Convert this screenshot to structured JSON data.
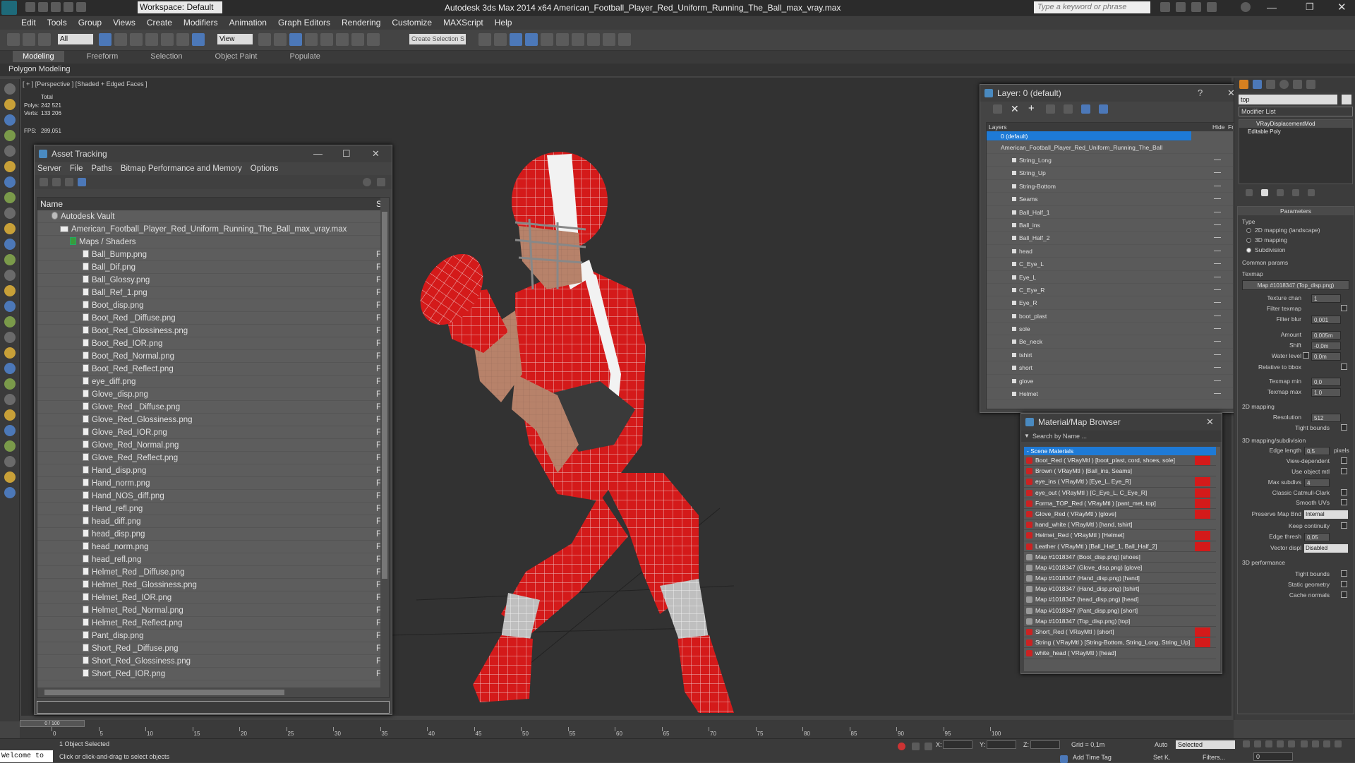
{
  "window": {
    "title": "Autodesk 3ds Max  2014 x64    American_Football_Player_Red_Uniform_Running_The_Ball_max_vray.max",
    "workspace": "Workspace: Default",
    "search_placeholder": "Type a keyword or phrase"
  },
  "menu": [
    "Edit",
    "Tools",
    "Group",
    "Views",
    "Create",
    "Modifiers",
    "Animation",
    "Graph Editors",
    "Rendering",
    "Customize",
    "MAXScript",
    "Help"
  ],
  "toolbar": {
    "selection_filter": "All",
    "ref_coord": "View",
    "named_selection": "Create Selection S"
  },
  "ribbon": {
    "tabs": [
      "Modeling",
      "Freeform",
      "Selection",
      "Object Paint",
      "Populate"
    ],
    "sub": "Polygon Modeling"
  },
  "viewport": {
    "label": "[ + ] [Perspective ] [Shaded + Edged Faces ]",
    "stats": {
      "total_label": "Total",
      "polys_label": "Polys:",
      "polys": "242 521",
      "verts_label": "Verts:",
      "verts": "133 206",
      "fps_label": "FPS:",
      "fps": "289,051"
    }
  },
  "asset_tracking": {
    "title": "Asset Tracking",
    "menu": [
      "Server",
      "File",
      "Paths",
      "Bitmap Performance and Memory",
      "Options"
    ],
    "col_name": "Name",
    "col_s": "S",
    "vault": "Autodesk Vault",
    "file": "American_Football_Player_Red_Uniform_Running_The_Ball_max_vray.max",
    "folder": "Maps / Shaders",
    "status_char": "F",
    "items": [
      "Ball_Bump.png",
      "Ball_Dif.png",
      "Ball_Glossy.png",
      "Ball_Ref_1.png",
      "Boot_disp.png",
      "Boot_Red _Diffuse.png",
      "Boot_Red_Glossiness.png",
      "Boot_Red_IOR.png",
      "Boot_Red_Normal.png",
      "Boot_Red_Reflect.png",
      "eye_diff.png",
      "Glove_disp.png",
      "Glove_Red _Diffuse.png",
      "Glove_Red_Glossiness.png",
      "Glove_Red_IOR.png",
      "Glove_Red_Normal.png",
      "Glove_Red_Reflect.png",
      "Hand_disp.png",
      "Hand_norm.png",
      "Hand_NOS_diff.png",
      "Hand_refl.png",
      "head_diff.png",
      "head_disp.png",
      "head_norm.png",
      "head_refl.png",
      "Helmet_Red _Diffuse.png",
      "Helmet_Red_Glossiness.png",
      "Helmet_Red_IOR.png",
      "Helmet_Red_Normal.png",
      "Helmet_Red_Reflect.png",
      "Pant_disp.png",
      "Short_Red _Diffuse.png",
      "Short_Red_Glossiness.png",
      "Short_Red_IOR.png"
    ]
  },
  "layers": {
    "title": "Layer: 0 (default)",
    "header": "Layers",
    "hide": "Hide",
    "fr": "Fr",
    "default_layer": "0 (default)",
    "main_layer": "American_Football_Player_Red_Uniform_Running_The_Ball",
    "items": [
      "String_Long",
      "String_Up",
      "String-Bottom",
      "Seams",
      "Ball_Half_1",
      "Ball_ins",
      "Ball_Half_2",
      "head",
      "C_Eye_L",
      "Eye_L",
      "C_Eye_R",
      "Eye_R",
      "boot_plast",
      "sole",
      "Be_neck",
      "tshirt",
      "short",
      "glove",
      "Helmet"
    ]
  },
  "material_browser": {
    "title": "Material/Map Browser",
    "search": "Search by Name ...",
    "section": "- Scene Materials",
    "items": [
      "Boot_Red  ( VRayMtl ) [boot_plast, cord, shoes, sole]",
      "Brown  ( VRayMtl ) [Ball_ins, Seams]",
      "eye_ins  ( VRayMtl ) [Eye_L, Eye_R]",
      "eye_out  ( VRayMtl ) [C_Eye_L, C_Eye_R]",
      "Forma_TOP_Red  ( VRayMtl ) [pant_met, top]",
      "Glove_Red  ( VRayMtl ) [glove]",
      "hand_white  ( VRayMtl ) [hand, tshirt]",
      "Helmet_Red  ( VRayMtl ) [Helmet]",
      "Leather  ( VRayMtl ) [Ball_Half_1, Ball_Half_2]",
      "Map #1018347 (Boot_disp.png) [shoes]",
      "Map #1018347 (Glove_disp.png) [glove]",
      "Map #1018347 (Hand_disp.png) [hand]",
      "Map #1018347 (Hand_disp.png) [tshirt]",
      "Map #1018347 (head_disp.png) [head]",
      "Map #1018347 (Pant_disp.png) [short]",
      "Map #1018347 (Top_disp.png) [top]",
      "Short_Red  ( VRayMtl ) [short]",
      "String  ( VRayMtl ) [String-Bottom, String_Long, String_Up]",
      "white_head  ( VRayMtl ) [head]"
    ]
  },
  "command_panel": {
    "name_field": "top",
    "modifier_list": "Modifier List",
    "stack": [
      "VRayDisplacementMod",
      "Editable Poly"
    ],
    "parameters": "Parameters",
    "type": "Type",
    "types": [
      "2D mapping (landscape)",
      "3D mapping",
      "Subdivision"
    ],
    "common_params": "Common params",
    "texmap": "Texmap",
    "texmap_value": "Map #1018347 (Top_disp.png)",
    "params": [
      {
        "label": "Texture chan",
        "value": "1"
      },
      {
        "label": "Filter texmap",
        "value": ""
      },
      {
        "label": "Filter blur",
        "value": "0,001"
      },
      {
        "label": "Amount",
        "value": "0,005m"
      },
      {
        "label": "Shift",
        "value": "-0,0m"
      },
      {
        "label": "Water level",
        "value": "0,0m"
      },
      {
        "label": "Relative to bbox",
        "value": ""
      },
      {
        "label": "Texmap min",
        "value": "0,0"
      },
      {
        "label": "Texmap max",
        "value": "1,0"
      }
    ],
    "mapping2d": "2D mapping",
    "resolution_label": "Resolution",
    "resolution": "512",
    "tight_bounds": "Tight bounds",
    "mapping3d": "3D mapping/subdivision",
    "sub_params": [
      {
        "label": "Edge length",
        "value": "0,5",
        "suffix": "pixels"
      },
      {
        "label": "View-dependent",
        "value": ""
      },
      {
        "label": "Use object mtl",
        "value": ""
      },
      {
        "label": "Max subdivs",
        "value": "4"
      },
      {
        "label": "Classic Catmull-Clark",
        "value": ""
      },
      {
        "label": "Smooth UVs",
        "value": ""
      },
      {
        "label": "Preserve Map Bnd",
        "value": "Internal"
      },
      {
        "label": "Keep continuity",
        "value": ""
      },
      {
        "label": "Edge thresh",
        "value": "0,05"
      },
      {
        "label": "Vector displ",
        "value": "Disabled"
      }
    ],
    "perf": "3D performance",
    "perf_items": [
      "Tight bounds",
      "Static geometry",
      "Cache normals"
    ]
  },
  "timeline": {
    "frame": "0 / 100",
    "ticks": [
      "0",
      "5",
      "10",
      "15",
      "20",
      "25",
      "30",
      "35",
      "40",
      "45",
      "50",
      "55",
      "60",
      "65",
      "70",
      "75",
      "80",
      "85",
      "90",
      "95",
      "100"
    ]
  },
  "status": {
    "welcome": "Welcome to",
    "selected": "1 Object Selected",
    "hint": "Click or click-and-drag to select objects",
    "x": "X:",
    "y": "Y:",
    "z": "Z:",
    "grid": "Grid = 0,1m",
    "add_time_tag": "Add Time Tag",
    "auto": "Auto",
    "set_key": "Set K.",
    "selected_dropdown": "Selected",
    "filters": "Filters...",
    "frame": "0"
  }
}
